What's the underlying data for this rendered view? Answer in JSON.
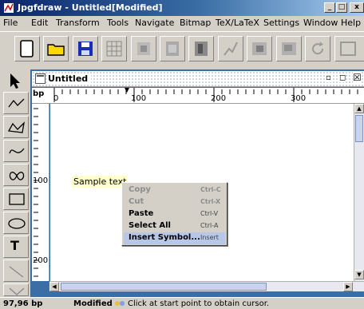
{
  "window": {
    "title": "Jpgfdraw - Untitled[Modified]",
    "controls": [
      "_",
      "□",
      "x"
    ]
  },
  "menubar": {
    "items": [
      "File",
      "Edit",
      "Transform",
      "Tools",
      "Navigate",
      "Bitmap",
      "TeX/LaTeX",
      "Settings",
      "Window",
      "Help"
    ]
  },
  "toolbar": {
    "buttons": [
      "new-document-icon",
      "open-folder-icon",
      "save-disk-icon",
      "grid-icon",
      "edit-path-icon",
      "layers-icon",
      "text-frame-icon",
      "curve-icon",
      "move-front-icon",
      "move-back-icon",
      "rotate-icon",
      "more-icon"
    ]
  },
  "palette": {
    "tools": [
      "select-arrow-icon",
      "open-line-icon",
      "closed-line-icon",
      "open-curve-icon",
      "closed-curve-icon",
      "rectangle-icon",
      "ellipse-icon",
      "text-tool-icon",
      "math-text-icon"
    ],
    "text_tool_glyph": "T"
  },
  "document": {
    "title": "Untitled",
    "ruler_unit": "bp",
    "ruler_h_labels": [
      "0",
      "100",
      "200",
      "300"
    ],
    "ruler_v_labels": [
      "100",
      "200"
    ],
    "sample_text": "Sample text"
  },
  "context_menu": {
    "items": [
      {
        "label": "Copy",
        "accel": "Ctrl-C",
        "enabled": false
      },
      {
        "label": "Cut",
        "accel": "Ctrl-X",
        "enabled": false
      },
      {
        "label": "Paste",
        "accel": "Ctrl-V",
        "enabled": true
      },
      {
        "label": "Select All",
        "accel": "Ctrl-A",
        "enabled": true
      },
      {
        "label": "Insert Symbol...",
        "accel": "Insert",
        "enabled": true,
        "selected": true
      }
    ]
  },
  "statusbar": {
    "position": "97,96 bp",
    "modified": "Modified",
    "message": "Click at start point to obtain cursor."
  },
  "colors": {
    "title_start": "#0a246a",
    "title_end": "#a6caf0",
    "frame": "#3a6ea5",
    "highlight": "#b7c7e8",
    "sample_bg": "#ffffcc"
  }
}
